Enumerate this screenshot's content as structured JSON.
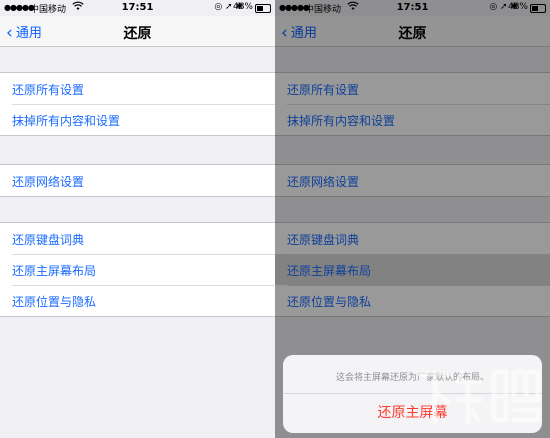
{
  "status": {
    "signal": "●●●●●",
    "carrier": "中国移动",
    "wifi_icon": "wifi-icon",
    "time": "17:51",
    "right_icons": "◎ ➚ ✱",
    "battery": "48%",
    "battery_level": 0.48
  },
  "nav": {
    "back_label": "通用",
    "title": "还原"
  },
  "groups": [
    {
      "items": [
        "还原所有设置",
        "抹掉所有内容和设置"
      ]
    },
    {
      "items": [
        "还原网络设置"
      ]
    },
    {
      "items": [
        "还原键盘词典",
        "还原主屏幕布局",
        "还原位置与隐私"
      ]
    }
  ],
  "action_sheet": {
    "message": "这会将主屏幕还原为厂家默认的布局。",
    "confirm_label": "还原主屏幕"
  },
  "watermark": "下载吧"
}
